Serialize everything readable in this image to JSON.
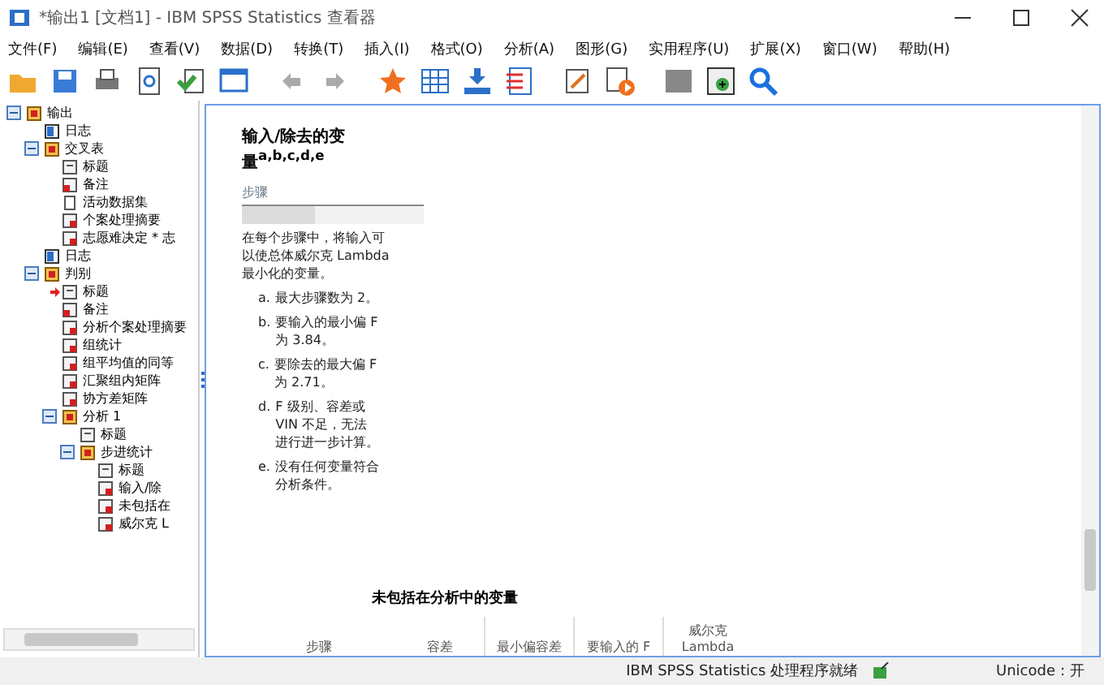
{
  "window": {
    "title": "*输出1 [文档1] - IBM SPSS Statistics 查看器"
  },
  "menu": [
    "文件(F)",
    "编辑(E)",
    "查看(V)",
    "数据(D)",
    "转换(T)",
    "插入(I)",
    "格式(O)",
    "分析(A)",
    "图形(G)",
    "实用程序(U)",
    "扩展(X)",
    "窗口(W)",
    "帮助(H)"
  ],
  "tree": [
    {
      "label": "输出",
      "kind": "output",
      "expanded": true,
      "current": false,
      "children": [
        {
          "label": "日志",
          "kind": "log",
          "current": false
        },
        {
          "label": "交叉表",
          "kind": "output",
          "expanded": true,
          "current": false,
          "children": [
            {
              "label": "标题",
              "kind": "title",
              "current": false
            },
            {
              "label": "备注",
              "kind": "note",
              "current": false
            },
            {
              "label": "活动数据集",
              "kind": "page",
              "current": false
            },
            {
              "label": "个案处理摘要",
              "kind": "table",
              "current": false
            },
            {
              "label": "志愿难决定 * 志",
              "kind": "table",
              "current": false
            }
          ]
        },
        {
          "label": "日志",
          "kind": "log",
          "current": false
        },
        {
          "label": "判别",
          "kind": "output",
          "expanded": true,
          "current": false,
          "children": [
            {
              "label": "标题",
              "kind": "title",
              "current": true
            },
            {
              "label": "备注",
              "kind": "note",
              "current": false
            },
            {
              "label": "分析个案处理摘要",
              "kind": "table",
              "current": false
            },
            {
              "label": "组统计",
              "kind": "table",
              "current": false
            },
            {
              "label": "组平均值的同等",
              "kind": "table",
              "current": false
            },
            {
              "label": "汇聚组内矩阵",
              "kind": "table",
              "current": false
            },
            {
              "label": "协方差矩阵",
              "kind": "table",
              "current": false
            },
            {
              "label": "分析 1",
              "kind": "output",
              "expanded": true,
              "current": false,
              "children": [
                {
                  "label": "标题",
                  "kind": "title",
                  "current": false
                },
                {
                  "label": "步进统计",
                  "kind": "output",
                  "expanded": true,
                  "current": false,
                  "children": [
                    {
                      "label": "标题",
                      "kind": "title",
                      "current": false
                    },
                    {
                      "label": "输入/除",
                      "kind": "table",
                      "current": false
                    },
                    {
                      "label": "未包括在",
                      "kind": "table",
                      "current": false
                    },
                    {
                      "label": "威尔克 L",
                      "kind": "table",
                      "current": false
                    }
                  ]
                }
              ]
            }
          ]
        }
      ]
    }
  ],
  "output": {
    "table_title": "输入/除去的变量$^{a,b,c,d,e}$",
    "column_header": "步骤",
    "note": "在每个步骤中，将输入可以使总体威尔克 Lambda 最小化的变量。",
    "footnotes": [
      {
        "mark": "a.",
        "text": "最大步骤数为 2。"
      },
      {
        "mark": "b.",
        "text": "要输入的最小偏 F 为 3.84。"
      },
      {
        "mark": "c.",
        "text": "要除去的最大偏 F 为 2.71。"
      },
      {
        "mark": "d.",
        "text": "F 级别、容差或 VIN 不足，无法进行进一步计算。"
      },
      {
        "mark": "e.",
        "text": "没有任何变量符合分析条件。"
      }
    ],
    "table2_title": "未包括在分析中的变量",
    "table2_columns": [
      "步骤",
      "容差",
      "最小偏容差",
      "要输入的 F",
      "威尔克 Lambda"
    ]
  },
  "status_bar": {
    "message": "IBM SPSS Statistics 处理程序就绪",
    "unicode": "Unicode：开"
  }
}
